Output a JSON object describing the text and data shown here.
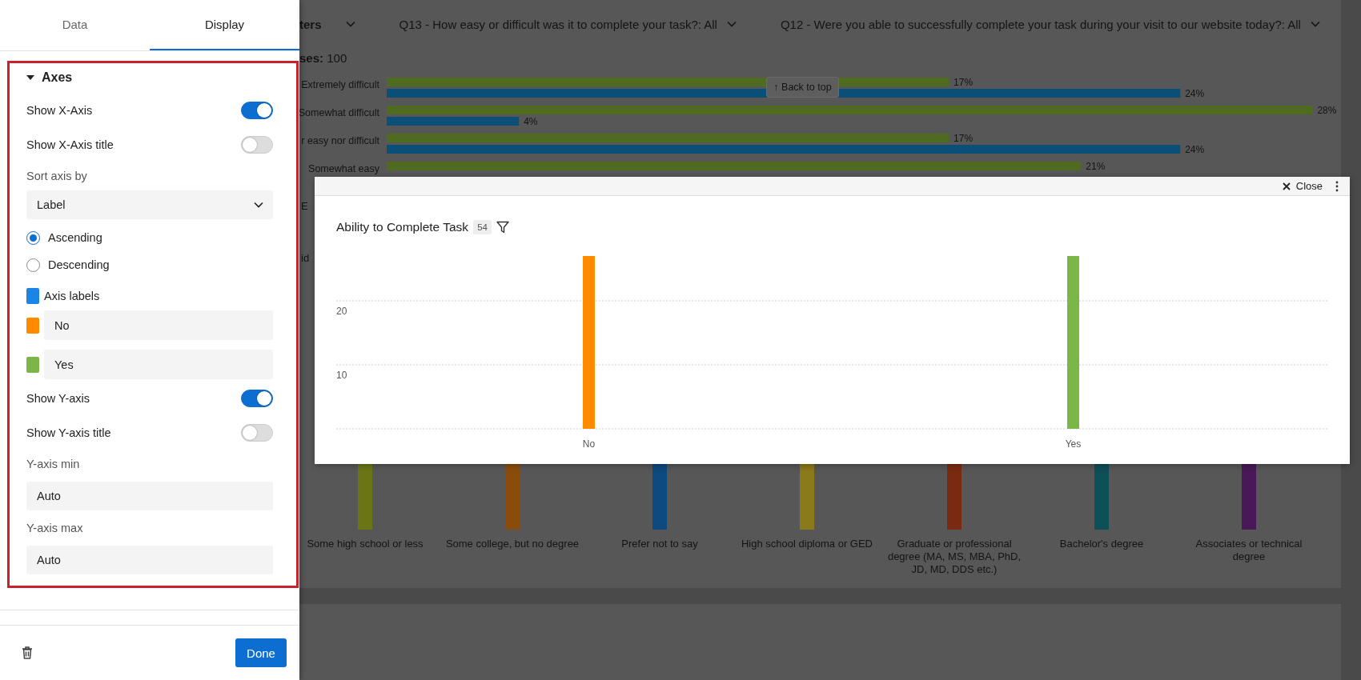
{
  "background": {
    "filters": [
      {
        "kind": "menu",
        "label": "ters"
      },
      {
        "kind": "filter",
        "label": "Q13 - How easy or difficult was it to complete your task?: All"
      },
      {
        "kind": "filter",
        "label": "Q12 - Were you able to successfully complete your task during your visit to our website today?: All"
      }
    ],
    "responses": "**ses:** 100",
    "back_to_top": "↑ Back to top",
    "chart_data": {
      "type": "bar",
      "orientation": "horizontal",
      "categories": [
        "Extremely difficult",
        "Somewhat difficult",
        "r easy nor difficult",
        "Somewhat easy"
      ],
      "series": [
        {
          "color": "#4f6b1f",
          "values": [
            17,
            28,
            17,
            21
          ],
          "value_labels": [
            "17%",
            "28%",
            "17%",
            "21%"
          ]
        },
        {
          "color": "#0a4f78",
          "values": [
            24,
            4,
            24,
            null
          ],
          "value_labels": [
            "24%",
            "4%",
            "24%",
            null
          ]
        }
      ]
    },
    "covered_labels": [
      "E",
      "id"
    ],
    "columns": [
      {
        "label": "Some high school or less",
        "color": "#6b7516"
      },
      {
        "label": "Some college, but no degree",
        "color": "#8a4c0a"
      },
      {
        "label": "Prefer not to say",
        "color": "#0d4a80"
      },
      {
        "label": "High school diploma or GED",
        "color": "#8a7a1a"
      },
      {
        "label": "Graduate or professional degree (MA, MS, MBA, PhD, JD, MD, DDS etc.)",
        "color": "#7a2a10"
      },
      {
        "label": "Bachelor's degree",
        "color": "#0d5058"
      },
      {
        "label": "Associates or technical degree",
        "color": "#4a1858"
      }
    ]
  },
  "panel": {
    "tabs": [
      {
        "label": "Data",
        "selected": false
      },
      {
        "label": "Display",
        "selected": true
      }
    ],
    "section": {
      "title": "Axes",
      "expanded": true,
      "items": [
        {
          "kind": "toggle",
          "label": "Show X-Axis",
          "on": true
        },
        {
          "kind": "toggle",
          "label": "Show X-Axis title",
          "on": false
        },
        {
          "kind": "select",
          "label": "Sort axis by",
          "value": "Label"
        },
        {
          "kind": "radio",
          "label": "Ascending",
          "selected": true
        },
        {
          "kind": "radio",
          "label": "Descending",
          "selected": false
        },
        {
          "kind": "swatch",
          "label": "Axis labels",
          "color": "#1a85e6"
        },
        {
          "kind": "swatch_field",
          "value": "No",
          "color": "#ff8a00"
        },
        {
          "kind": "swatch_field",
          "value": "Yes",
          "color": "#7ab648"
        },
        {
          "kind": "toggle",
          "label": "Show Y-axis",
          "on": true
        },
        {
          "kind": "toggle",
          "label": "Show Y-axis title",
          "on": false
        },
        {
          "kind": "field",
          "label": "Y-axis min",
          "value": "Auto"
        },
        {
          "kind": "field",
          "label": "Y-axis max",
          "value": "Auto"
        }
      ]
    },
    "done_button": "Done"
  },
  "modal": {
    "close": "Close",
    "title": "Ability to Complete Task",
    "count": "54",
    "chart_data": {
      "type": "bar",
      "categories": [
        "No",
        "Yes"
      ],
      "series": [
        {
          "color": "#ff8a00",
          "values": [
            27,
            null
          ]
        },
        {
          "color": "#7ab648",
          "values": [
            null,
            27
          ]
        }
      ],
      "ylim": [
        -5.375,
        39.5
      ],
      "yticks": [
        10,
        20
      ]
    }
  }
}
